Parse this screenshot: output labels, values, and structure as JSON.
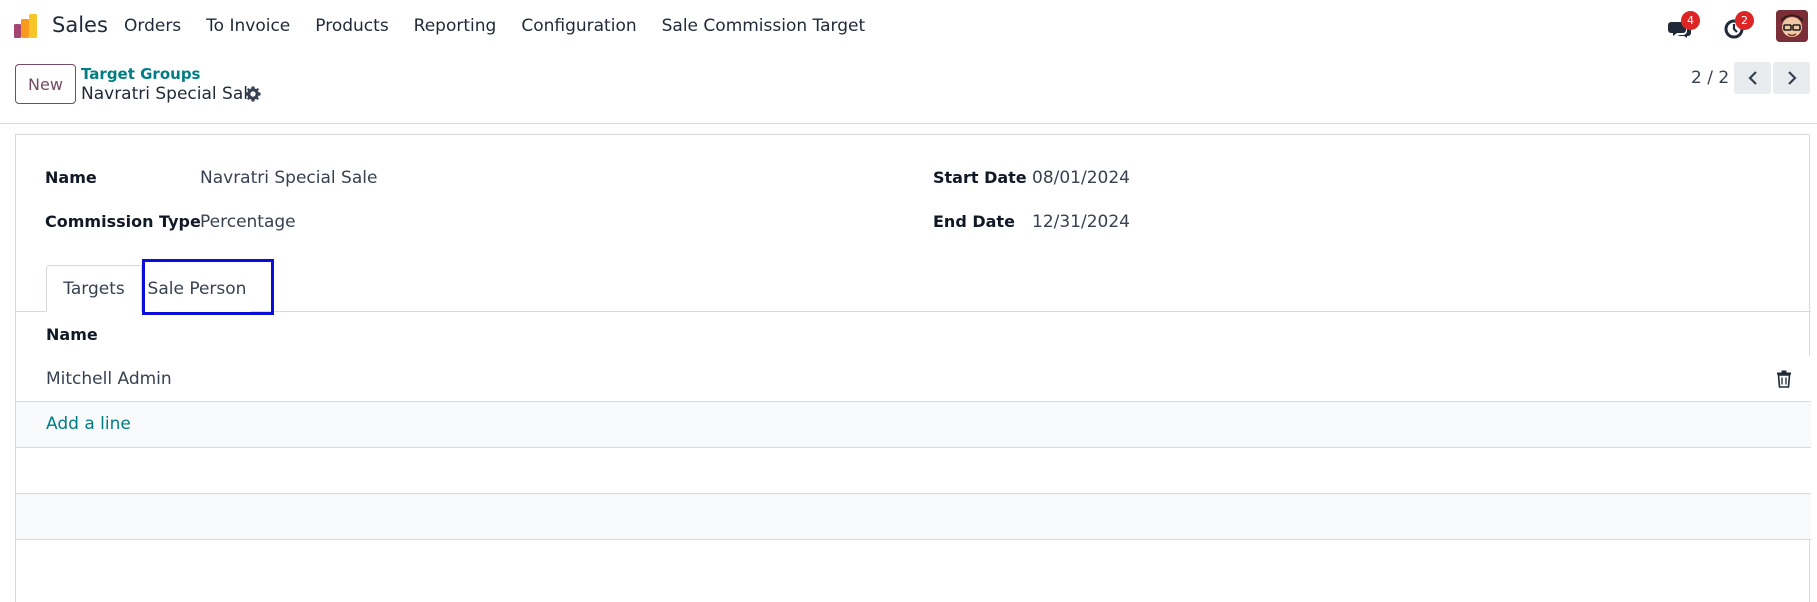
{
  "nav": {
    "app_name": "Sales",
    "menu": [
      "Orders",
      "To Invoice",
      "Products",
      "Reporting",
      "Configuration",
      "Sale Commission Target"
    ],
    "messages_count": "4",
    "activities_count": "2"
  },
  "control": {
    "new_label": "New",
    "breadcrumb_parent": "Target Groups",
    "breadcrumb_current": "Navratri Special Sale",
    "pager": "2 / 2"
  },
  "form": {
    "name_label": "Name",
    "name_value": "Navratri Special Sale",
    "commission_type_label": "Commission Type",
    "commission_type_value": "Percentage",
    "start_date_label": "Start Date",
    "start_date_value": "08/01/2024",
    "end_date_label": "End Date",
    "end_date_value": "12/31/2024"
  },
  "tabs": [
    "Targets",
    "Sale Person"
  ],
  "list": {
    "column_header": "Name",
    "rows": [
      "Mitchell Admin"
    ],
    "add_line_label": "Add a line"
  },
  "colors": {
    "brand": "#714b67",
    "link": "#017e84",
    "badge": "#dc2626",
    "highlight": "#0d0dd9"
  },
  "icons": [
    "app-logo-icon",
    "chat-icon",
    "clock-icon",
    "gear-icon",
    "chevron-left-icon",
    "chevron-right-icon",
    "trash-icon"
  ]
}
